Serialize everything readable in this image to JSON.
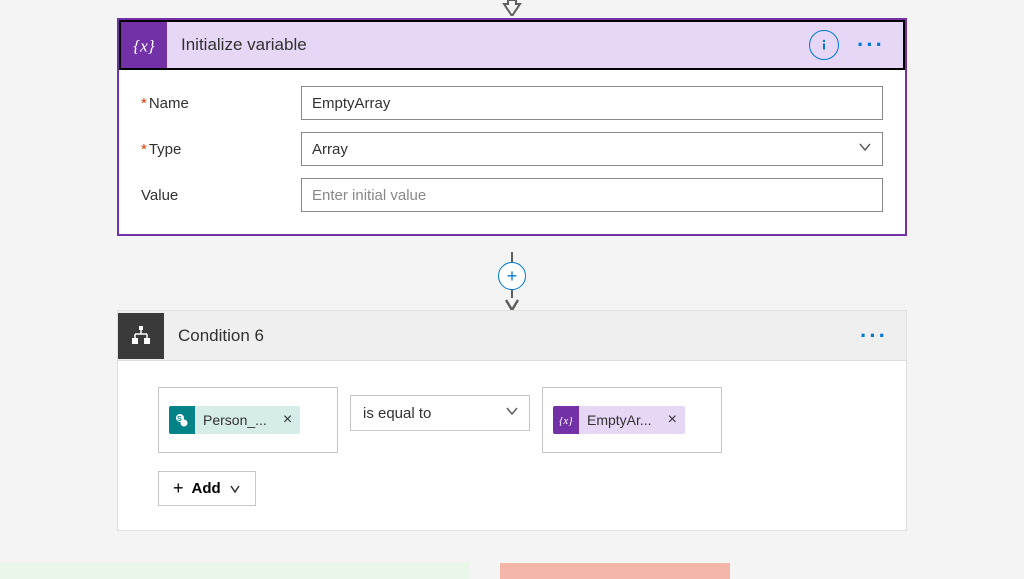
{
  "initStep": {
    "title": "Initialize variable",
    "fields": {
      "nameLabel": "Name",
      "nameValue": "EmptyArray",
      "typeLabel": "Type",
      "typeValue": "Array",
      "valueLabel": "Value",
      "valuePlaceholder": "Enter initial value"
    }
  },
  "condStep": {
    "title": "Condition 6",
    "leftToken": "Person_...",
    "operator": "is equal to",
    "rightToken": "EmptyAr...",
    "addLabel": "Add"
  }
}
